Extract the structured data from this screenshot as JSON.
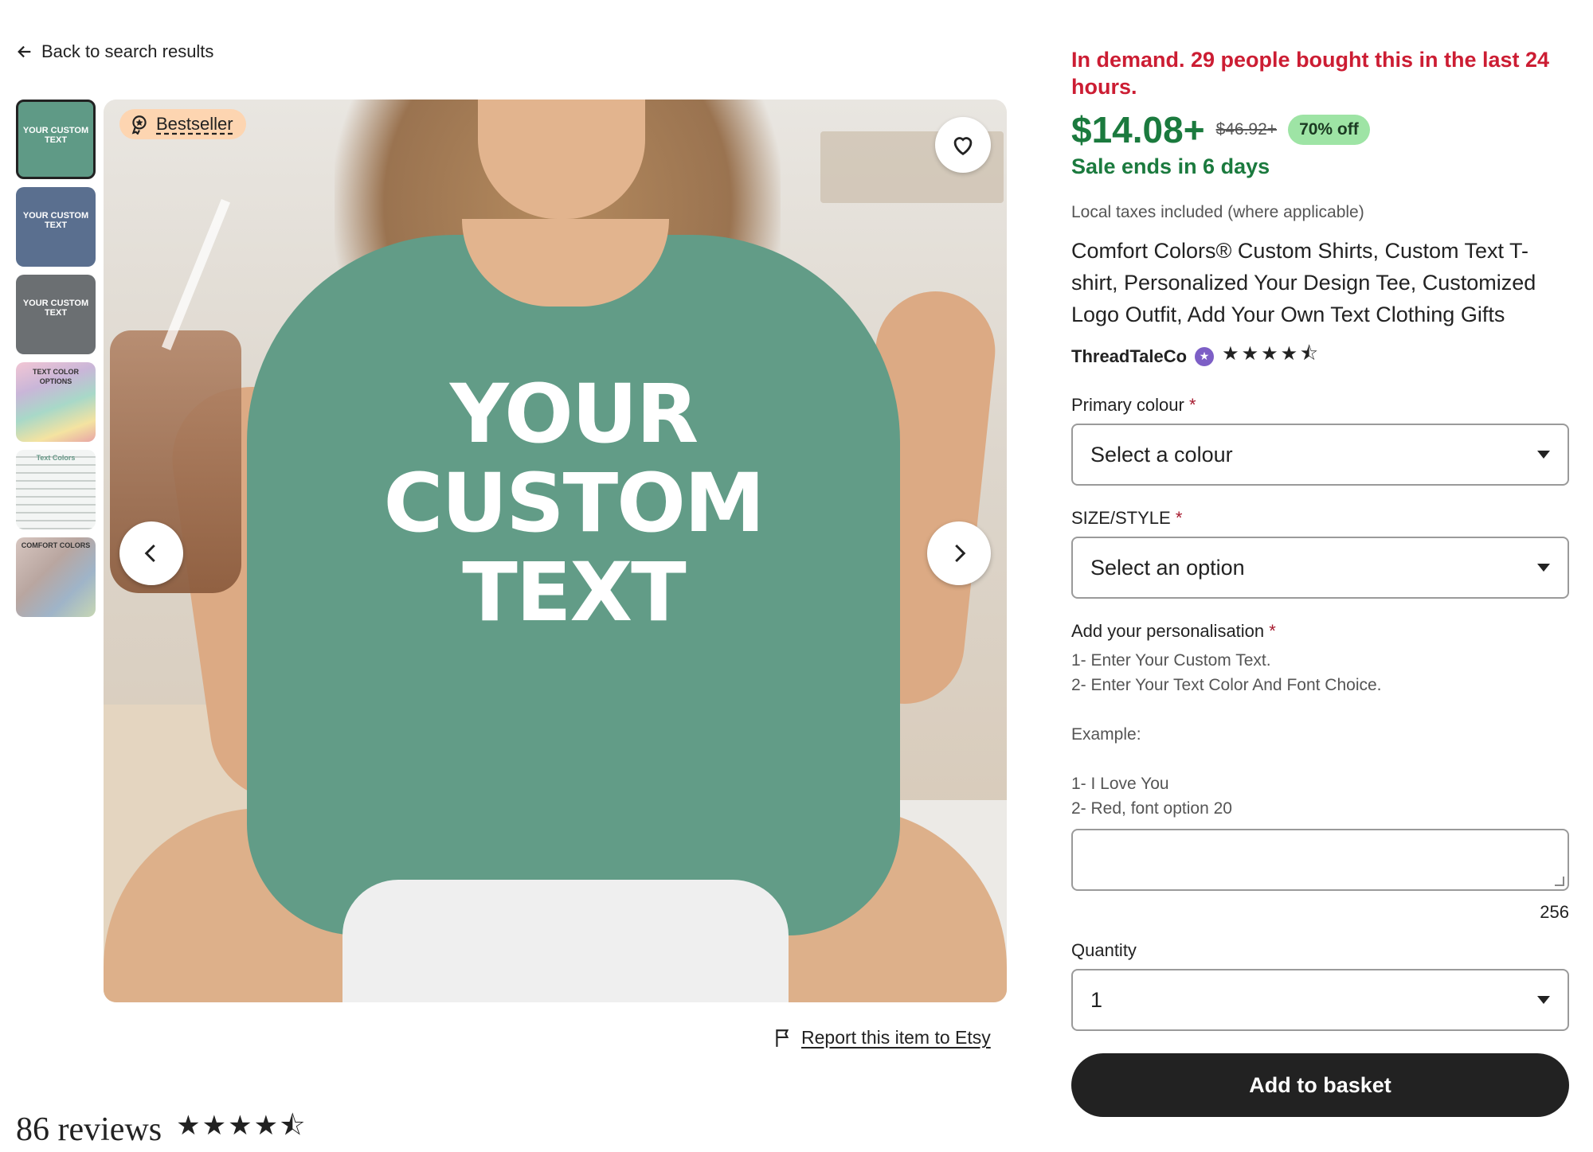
{
  "nav": {
    "back_label": "Back to search results"
  },
  "gallery": {
    "thumbnails": [
      {
        "label": "YOUR CUSTOM TEXT",
        "color": "#5f9a86"
      },
      {
        "label": "YOUR CUSTOM TEXT",
        "color": "#5a6f8f"
      },
      {
        "label": "YOUR CUSTOM TEXT",
        "color": "#6b6f72"
      },
      {
        "label": "TEXT COLOR OPTIONS",
        "color": "#c9b6d8"
      },
      {
        "label": "Text Colors",
        "color": "#e7ebe9"
      },
      {
        "label": "COMFORT COLORS",
        "color": "#b9a6a0"
      }
    ],
    "badge_label": "Bestseller",
    "shirt_lines": [
      "YOUR",
      "CUSTOM",
      "TEXT"
    ]
  },
  "report_label": "Report this item to Etsy",
  "reviews": {
    "count_label": "86 reviews",
    "rating_stars": "★★★★⯪"
  },
  "product": {
    "demand": "In demand. 29 people bought this in the last 24 hours.",
    "price": "$14.08+",
    "original_price": "$46.92+",
    "discount": "70% off",
    "sale_ends": "Sale ends in 6 days",
    "tax_note": "Local taxes included (where applicable)",
    "title": "Comfort Colors® Custom Shirts, Custom Text T-shirt, Personalized Your Design Tee, Customized Logo Outfit, Add Your Own Text Clothing Gifts",
    "shop": "ThreadTaleCo",
    "shop_stars": "★★★★⯪"
  },
  "form": {
    "colour_label": "Primary colour",
    "colour_value": "Select a colour",
    "size_label": "SIZE/STYLE",
    "size_value": "Select an option",
    "personalisation_label": "Add your personalisation",
    "instructions": [
      "1- Enter Your Custom Text.",
      "2- Enter Your Text Color And Font Choice.",
      "Example:",
      "1- I Love You",
      "2- Red, font option 20"
    ],
    "char_counter": "256",
    "quantity_label": "Quantity",
    "quantity_value": "1",
    "required_mark": "*",
    "add_to_basket": "Add to basket"
  },
  "colors": {
    "price_green": "#1b7a3e",
    "demand_red": "#cc1d33",
    "discount_bg": "#9ee4a5",
    "bestseller_bg": "#fdd5b1",
    "button_bg": "#222222"
  }
}
